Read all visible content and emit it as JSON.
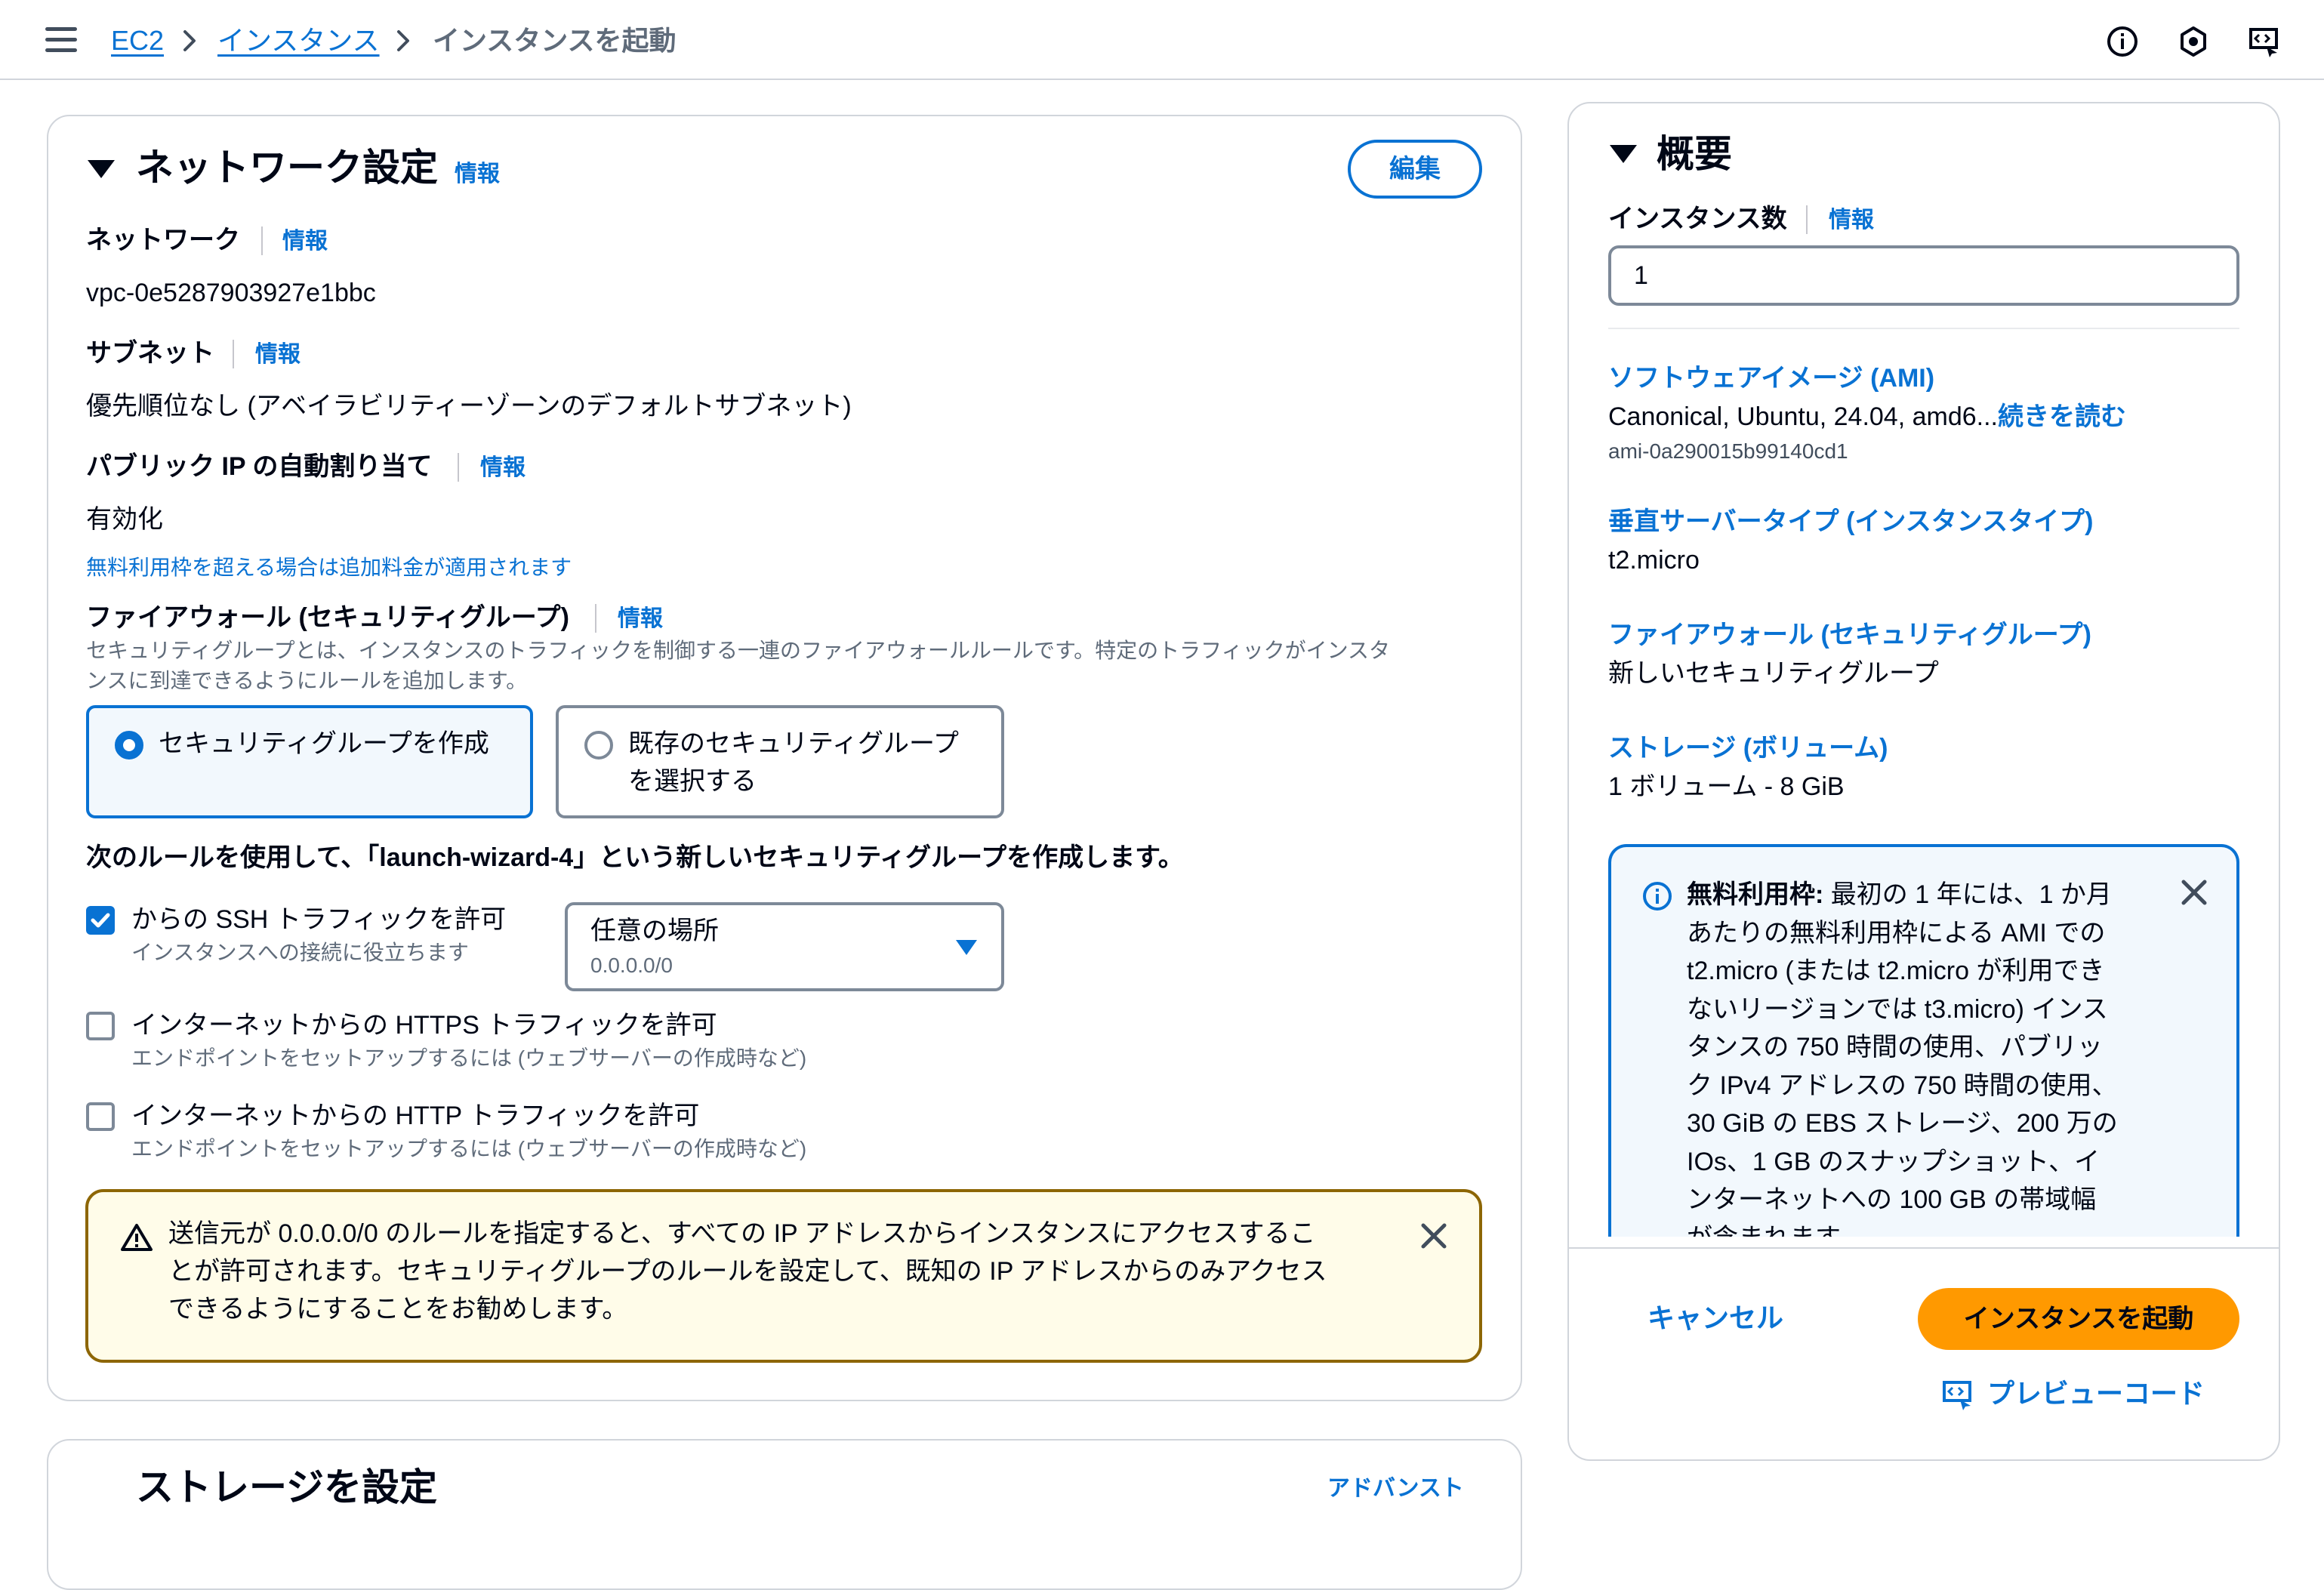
{
  "breadcrumb": {
    "items": [
      "EC2",
      "インスタンス",
      "インスタンスを起動"
    ]
  },
  "network": {
    "title": "ネットワーク設定",
    "info": "情報",
    "edit_label": "編集",
    "network_label": "ネットワーク",
    "network_value": "vpc-0e5287903927e1bbc",
    "subnet_label": "サブネット",
    "subnet_value": "優先順位なし (アベイラビリティーゾーンのデフォルトサブネット)",
    "public_ip_label": "パブリック IP の自動割り当て",
    "public_ip_value": "有効化",
    "free_tier_note_prefix": "無料利用枠を超える場合は",
    "free_tier_note_link": "追加料金が適用されます",
    "firewall_label": "ファイアウォール (セキュリティグループ)",
    "firewall_desc_1": "セキュリティグループとは、インスタンスのトラフィックを制御する一連のファイアウォールルールです。特定のトラフィックがインスタ",
    "firewall_desc_2": "ンスに到達できるようにルールを追加します。",
    "radio_create": "セキュリティグループを作成",
    "radio_existing_1": "既存のセキュリティグループ",
    "radio_existing_2": "を選択する",
    "rule_intro": "次のルールを使用して、「launch-wizard-4」という新しいセキュリティグループを作成します。",
    "ssh_label": "からの SSH トラフィックを許可",
    "ssh_desc": "インスタンスへの接続に役立ちます",
    "ssh_source_label": "任意の場所",
    "ssh_source_value": "0.0.0.0/0",
    "https_label": "インターネットからの HTTPS トラフィックを許可",
    "https_desc": "エンドポイントをセットアップするには (ウェブサーバーの作成時など)",
    "http_label": "インターネットからの HTTP トラフィックを許可",
    "http_desc": "エンドポイントをセットアップするには (ウェブサーバーの作成時など)",
    "warning_1": "送信元が 0.0.0.0/0 のルールを指定すると、すべての IP アドレスからインスタンスにアクセスするこ",
    "warning_2": "とが許可されます。セキュリティグループのルールを設定して、既知の IP アドレスからのみアクセス",
    "warning_3": "できるようにすることをお勧めします。"
  },
  "storage": {
    "title": "ストレージを設定",
    "advanced": "アドバンスト"
  },
  "summary": {
    "title": "概要",
    "instance_count_label": "インスタンス数",
    "info": "情報",
    "instance_count_value": "1",
    "ami_label": "ソフトウェアイメージ (AMI)",
    "ami_value": "Canonical, Ubuntu, 24.04, amd6...",
    "ami_more": "続きを読む",
    "ami_id": "ami-0a290015b99140cd1",
    "type_label": "垂直サーバータイプ (インスタンスタイプ)",
    "type_value": "t2.micro",
    "firewall_label": "ファイアウォール (セキュリティグループ)",
    "firewall_value": "新しいセキュリティグループ",
    "storage_label": "ストレージ (ボリューム)",
    "storage_value": "1 ボリューム - 8 GiB",
    "free_tier_title": "無料利用枠:",
    "free_tier_lines": [
      " 最初の 1 年には、1 か月",
      "あたりの無料利用枠による AMI での",
      "t2.micro (または t2.micro が利用でき",
      "ないリージョンでは t3.micro) インス",
      "タンスの 750 時間の使用、パブリッ",
      "ク IPv4 アドレスの 750 時間の使用、",
      "30 GiB の EBS ストレージ、200 万の",
      "IOs、1 GB のスナップショット、イ",
      "ンターネットへの 100 GB の帯域幅",
      "が含まれます。"
    ],
    "cancel_label": "キャンセル",
    "launch_label": "インスタンスを起動",
    "preview_label": "プレビューコード"
  },
  "colors": {
    "link": "#0972d3",
    "primary_button": "#ff9900",
    "warning_border": "#8d6605",
    "info_bg": "#f2f8fd"
  },
  "icons": [
    "menu-icon",
    "chevron-right-icon",
    "info-circle-icon",
    "settings-hex-icon",
    "preview-code-icon",
    "warning-icon",
    "close-icon",
    "caret-down-icon",
    "checkmark-icon"
  ]
}
